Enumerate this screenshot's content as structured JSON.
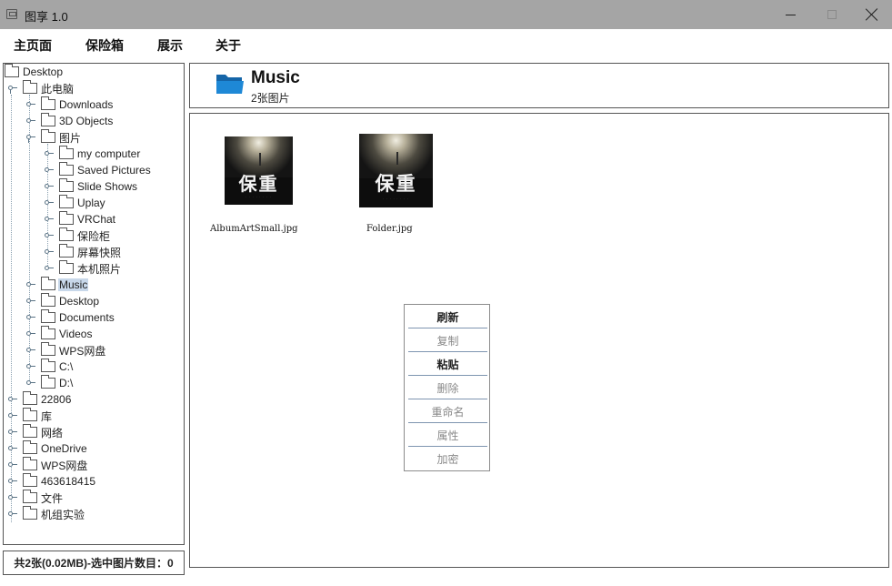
{
  "window": {
    "title": "图享 1.0"
  },
  "menubar": {
    "items": [
      "主页面",
      "保险箱",
      "展示",
      "关于"
    ]
  },
  "tree": {
    "root": "Desktop",
    "this_pc": "此电脑",
    "downloads": "Downloads",
    "objects3d": "3D Objects",
    "pictures": "图片",
    "pictures_children": [
      "my computer",
      "Saved Pictures",
      "Slide Shows",
      "Uplay",
      "VRChat",
      "保险柜",
      "屏幕快照",
      "本机照片"
    ],
    "music": "Music",
    "desktop": "Desktop",
    "documents": "Documents",
    "videos": "Videos",
    "wps_drive": "WPS网盘",
    "c_drive": "C:\\",
    "d_drive": "D:\\",
    "top_level": [
      "22806",
      "库",
      "网络",
      "OneDrive",
      "WPS网盘",
      "463618415",
      "文件",
      "机组实验"
    ],
    "selected": "Music"
  },
  "status": {
    "text": "共2张(0.02MB)-选中图片数目：0"
  },
  "header": {
    "folder_name": "Music",
    "count": "2张图片"
  },
  "images": [
    {
      "filename": "AlbumArtSmall.jpg",
      "art_title": "保重"
    },
    {
      "filename": "Folder.jpg",
      "art_title": "保重"
    }
  ],
  "context_menu": {
    "items": [
      {
        "label": "刷新",
        "enabled": true
      },
      {
        "label": "复制",
        "enabled": false
      },
      {
        "label": "粘贴",
        "enabled": true
      },
      {
        "label": "删除",
        "enabled": false
      },
      {
        "label": "重命名",
        "enabled": false
      },
      {
        "label": "属性",
        "enabled": false
      },
      {
        "label": "加密",
        "enabled": false
      }
    ]
  },
  "colors": {
    "titlebar": "#a5a5a5",
    "selection": "#c8d8ea",
    "folder_blue": "#1e88d6",
    "separator": "#7e95b0"
  },
  "icons": {
    "app": "image-app-icon",
    "folder": "folder-icon",
    "tree_handle": "tree-toggle-icon"
  }
}
